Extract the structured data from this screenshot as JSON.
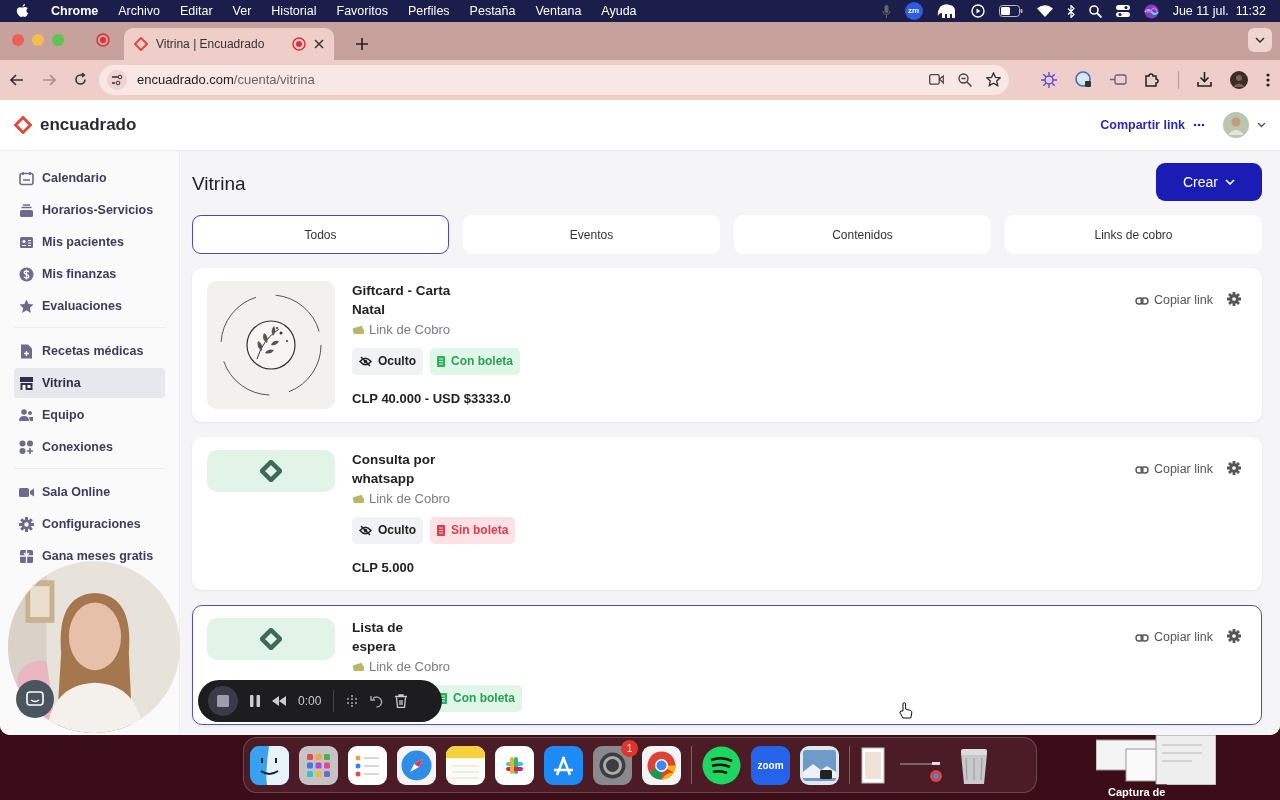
{
  "menu_bar": {
    "app": "Chrome",
    "menus": [
      "Archivo",
      "Editar",
      "Ver",
      "Historial",
      "Favoritos",
      "Perfiles",
      "Pestaña",
      "Ventana",
      "Ayuda"
    ],
    "zoom_badge": "zm",
    "clock": "Jue 11 jul.  11:32"
  },
  "browser": {
    "tab": {
      "title": "Vitrina | Encuadrado",
      "selected": true
    },
    "url": {
      "host": "encuadrado.com",
      "path": "/cuenta/vitrina"
    }
  },
  "header": {
    "brand": "encuadrado",
    "share_link": "Compartir link"
  },
  "sidebar": {
    "groups": [
      [
        {
          "label": "Calendario",
          "selected": false
        },
        {
          "label": "Horarios-Servicios",
          "selected": false
        },
        {
          "label": "Mis pacientes",
          "selected": false
        },
        {
          "label": "Mis finanzas",
          "selected": false
        },
        {
          "label": "Evaluaciones",
          "selected": false
        }
      ],
      [
        {
          "label": "Recetas médicas",
          "selected": false
        },
        {
          "label": "Vitrina",
          "selected": true
        },
        {
          "label": "Equipo",
          "selected": false
        },
        {
          "label": "Conexiones",
          "selected": false
        }
      ],
      [
        {
          "label": "Sala Online",
          "selected": false
        },
        {
          "label": "Configuraciones",
          "selected": false
        },
        {
          "label": "Gana meses gratis",
          "selected": false
        }
      ]
    ]
  },
  "page": {
    "title": "Vitrina",
    "create_button": "Crear",
    "tabs": [
      {
        "label": "Todos",
        "selected": true
      },
      {
        "label": "Eventos",
        "selected": false
      },
      {
        "label": "Contenidos",
        "selected": false
      },
      {
        "label": "Links de cobro",
        "selected": false
      }
    ],
    "items": [
      {
        "kind": "picture",
        "title_lines": [
          "Giftcard - Carta",
          "Natal"
        ],
        "type": "Link de Cobro",
        "visibility": "Oculto",
        "receipt": {
          "label": "Con boleta",
          "issued": true
        },
        "price": "CLP 40.000 - USD $3333.0",
        "highlighted": false,
        "copy_link": "Copiar link"
      },
      {
        "kind": "logo",
        "title_lines": [
          "Consulta por",
          "whatsapp"
        ],
        "type": "Link de Cobro",
        "visibility": "Oculto",
        "receipt": {
          "label": "Sin boleta",
          "issued": false
        },
        "price": "CLP 5.000",
        "highlighted": false,
        "copy_link": "Copiar link"
      },
      {
        "kind": "logo",
        "title_lines": [
          "Lista de",
          "espera"
        ],
        "type": "Link de Cobro",
        "receipt": {
          "label": "Con boleta",
          "issued": true
        },
        "highlighted": true,
        "copy_link": "Copiar link"
      }
    ]
  },
  "recorder": {
    "time": "0:00"
  },
  "dock": {
    "zoom_label": "zoom",
    "notification_badge": "1"
  },
  "desktop": {
    "file_label": "Captura de"
  }
}
